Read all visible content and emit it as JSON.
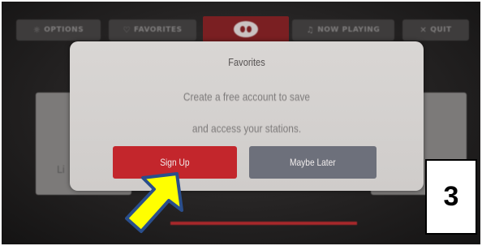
{
  "topbar": {
    "tabs": [
      {
        "label": "OPTIONS",
        "icon": "gear-icon"
      },
      {
        "label": "FAVORITES",
        "icon": "favorites-icon"
      },
      {
        "label": "NOW PLAYING",
        "icon": "music-note-icon"
      },
      {
        "label": "QUIT",
        "icon": "close-icon"
      }
    ],
    "center_logo": "iheart-logo"
  },
  "background": {
    "card_fragment": "Li"
  },
  "dialog": {
    "title": "Favorites",
    "message_line1": "Create a free account to save",
    "message_line2": "and access your stations.",
    "primary_label": "Sign Up",
    "secondary_label": "Maybe Later"
  },
  "annotation": {
    "step_number": "3",
    "arrow_color": "#ffff00",
    "arrow_outline_color": "#2a4e8c"
  },
  "colors": {
    "signup_button": "#c3262c",
    "maybe_later_button": "#6d707b",
    "iheart_tab": "#7a1f22"
  }
}
